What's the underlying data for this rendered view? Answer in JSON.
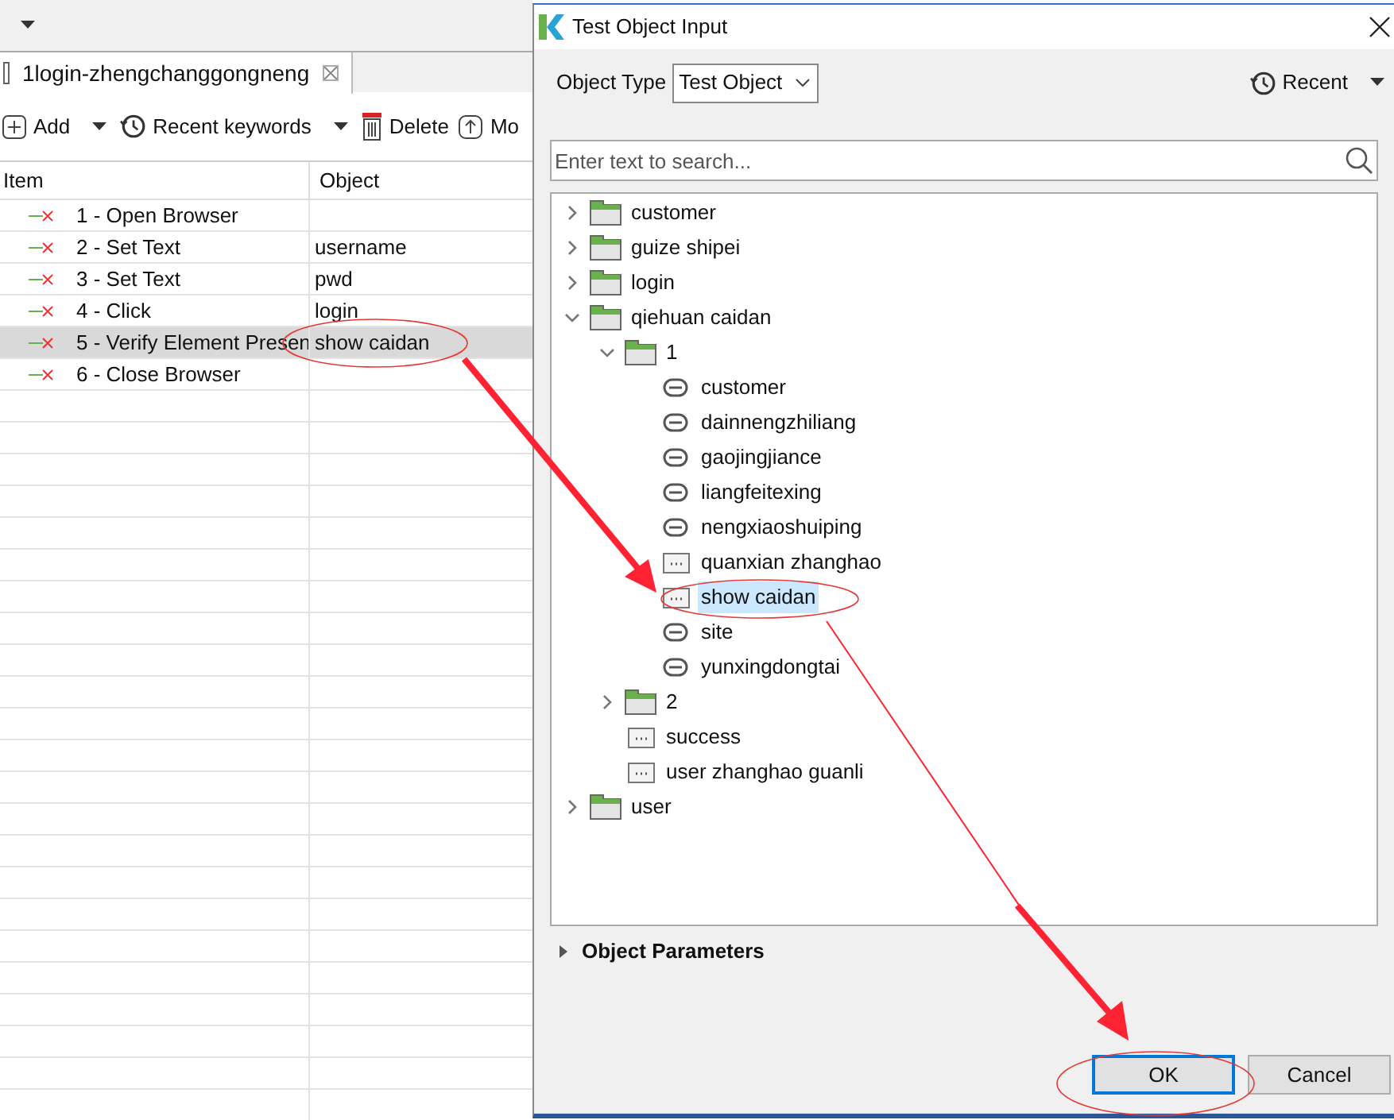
{
  "editor": {
    "tab": {
      "title": "1login-zhengchanggongneng",
      "selected": true
    },
    "toolbar": [
      {
        "kind": "add",
        "label": "Add",
        "menu": true
      },
      {
        "kind": "recent",
        "label": "Recent keywords",
        "menu": true
      },
      {
        "kind": "delete",
        "label": "Delete",
        "menu": false
      },
      {
        "kind": "move",
        "label": "Mo",
        "menu": false
      }
    ],
    "table": {
      "columns": [
        "Item",
        "Object"
      ],
      "rows": [
        {
          "item": "1 - Open Browser",
          "object": "",
          "selected": false
        },
        {
          "item": "2 - Set Text",
          "object": "username",
          "selected": false
        },
        {
          "item": "3 - Set Text",
          "object": "pwd",
          "selected": false
        },
        {
          "item": "4 - Click",
          "object": "login",
          "selected": false
        },
        {
          "item": "5 - Verify Element Presen",
          "object": "show caidan",
          "selected": true
        },
        {
          "item": "6 - Close Browser",
          "object": "",
          "selected": false
        }
      ]
    }
  },
  "dialog": {
    "title": "Test Object Input",
    "object_type_label": "Object Type",
    "object_type_value": "Test Object",
    "recent": "Recent",
    "search": {
      "placeholder": "Enter text to search..."
    },
    "tree": [
      {
        "kind": "folder",
        "label": "customer",
        "expanded": false,
        "selected": false
      },
      {
        "kind": "folder",
        "label": "guize shipei",
        "expanded": false,
        "selected": false
      },
      {
        "kind": "folder",
        "label": "login",
        "expanded": false,
        "selected": false
      },
      {
        "kind": "folder",
        "label": "qiehuan caidan",
        "expanded": true,
        "selected": false,
        "children": [
          {
            "kind": "folder",
            "label": "1",
            "expanded": true,
            "selected": false,
            "children": [
              {
                "kind": "link",
                "label": "customer",
                "selected": false
              },
              {
                "kind": "link",
                "label": "dainnengzhiliang",
                "selected": false
              },
              {
                "kind": "link",
                "label": "gaojingjiance",
                "selected": false
              },
              {
                "kind": "link",
                "label": "liangfeitexing",
                "selected": false
              },
              {
                "kind": "link",
                "label": "nengxiaoshuiping",
                "selected": false
              },
              {
                "kind": "object",
                "label": "quanxian zhanghao",
                "selected": false
              },
              {
                "kind": "object",
                "label": "show caidan",
                "selected": true
              },
              {
                "kind": "link",
                "label": "site",
                "selected": false
              },
              {
                "kind": "link",
                "label": "yunxingdongtai",
                "selected": false
              }
            ]
          },
          {
            "kind": "folder",
            "label": "2",
            "expanded": false,
            "selected": false
          },
          {
            "kind": "object",
            "label": "success",
            "selected": false
          },
          {
            "kind": "object",
            "label": "user zhanghao guanli",
            "selected": false
          }
        ]
      },
      {
        "kind": "folder",
        "label": "user",
        "expanded": false,
        "selected": false
      }
    ],
    "parameters": {
      "label": "Object Parameters",
      "expanded": false
    },
    "buttons": [
      {
        "label": "OK",
        "default": true
      },
      {
        "label": "Cancel",
        "default": false
      }
    ]
  }
}
